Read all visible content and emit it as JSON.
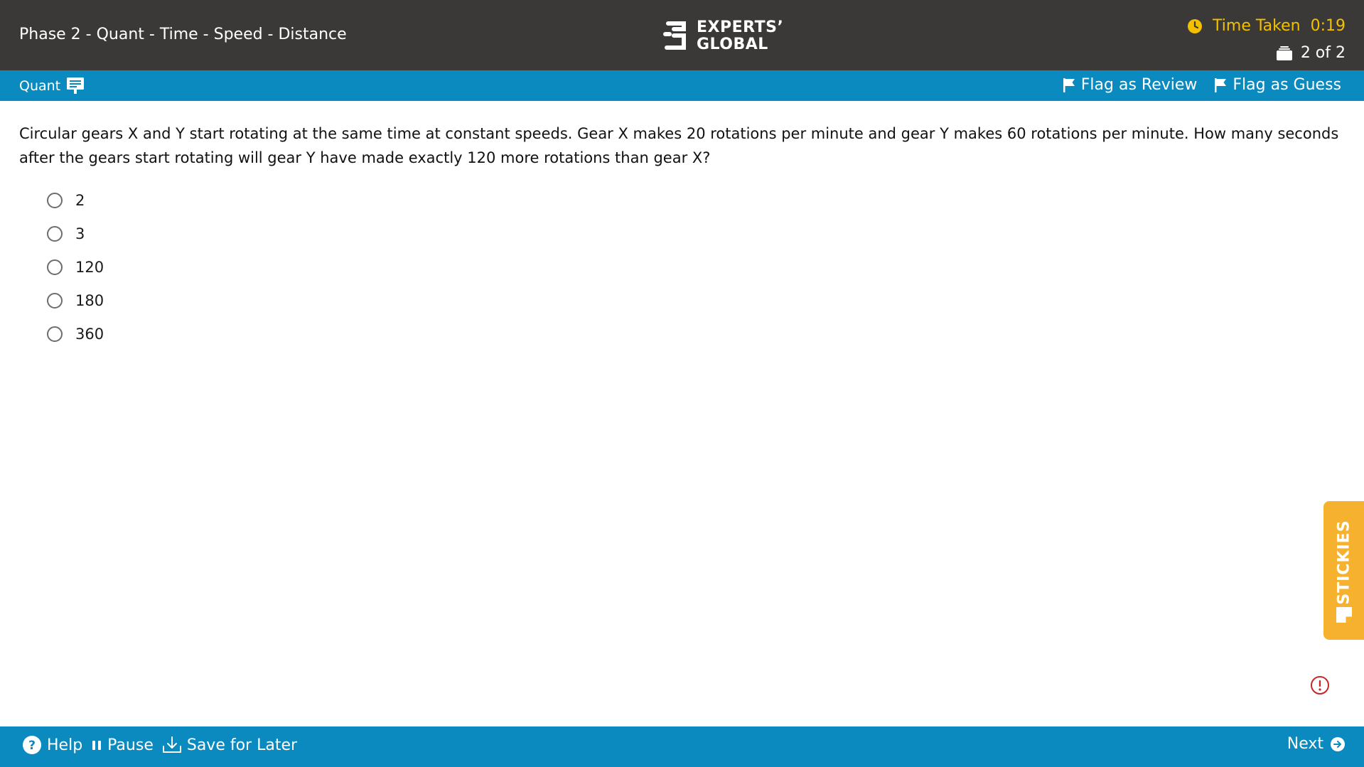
{
  "header": {
    "title": "Phase 2 - Quant - Time - Speed - Distance",
    "logo_line1": "EXPERTS’",
    "logo_line2": "GLOBAL",
    "time_label": "Time Taken",
    "time_value": "0:19",
    "progress": "2 of 2"
  },
  "section_bar": {
    "section_name": "Quant",
    "flag_review": "Flag as Review",
    "flag_guess": "Flag as Guess"
  },
  "question": {
    "text": "Circular gears X and Y start rotating at the same time at constant speeds. Gear X makes 20 rotations per minute and gear Y makes 60 rotations per minute. How many seconds after the gears start rotating will gear Y have made exactly 120 more rotations than gear X?",
    "options": [
      "2",
      "3",
      "120",
      "180",
      "360"
    ]
  },
  "stickies": {
    "label": "STICKIES"
  },
  "footer": {
    "help": "Help",
    "pause": "Pause",
    "save_later": "Save for Later",
    "next": "Next"
  },
  "colors": {
    "header_bg": "#3b3838",
    "accent_blue": "#0a8abf",
    "timer_yellow": "#f3c000",
    "stickies_orange": "#f6b22f",
    "alert_red": "#c62828"
  },
  "icons": [
    "clock-icon",
    "stack-icon",
    "calculator-icon",
    "flag-icon",
    "sticky-note-icon",
    "alert-icon",
    "help-icon",
    "pause-icon",
    "download-icon",
    "arrow-right-icon"
  ]
}
